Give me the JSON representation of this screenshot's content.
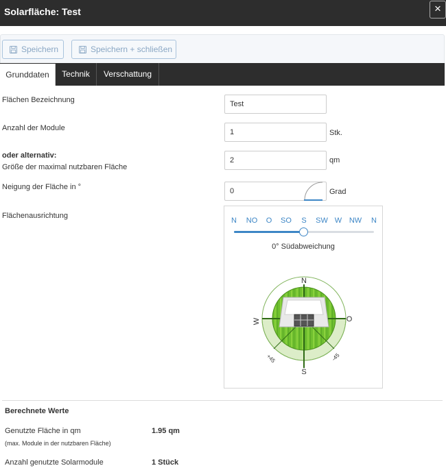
{
  "window": {
    "title": "Solarfläche: Test",
    "close_symbol": "×"
  },
  "toolbar": {
    "save_label": "Speichern",
    "save_close_label": "Speichern + schließen"
  },
  "tabs": [
    {
      "label": "Grunddaten",
      "active": true
    },
    {
      "label": "Technik",
      "active": false
    },
    {
      "label": "Verschattung",
      "active": false
    }
  ],
  "form": {
    "name": {
      "label": "Flächen Bezeichnung",
      "value": "Test"
    },
    "modules": {
      "label": "Anzahl der Module",
      "value": "1",
      "unit": "Stk."
    },
    "area": {
      "label_bold": "oder alternativ:",
      "label": "Größe der maximal nutzbaren Fläche",
      "value": "2",
      "unit": "qm"
    },
    "tilt": {
      "label": "Neigung der Fläche in °",
      "value": "0",
      "unit": "Grad"
    },
    "orientation": {
      "label": "Flächenausrichtung",
      "directions": [
        "N",
        "NO",
        "O",
        "SO",
        "S",
        "SW",
        "W",
        "NW",
        "N"
      ],
      "slider_fraction": 0.5,
      "deviation_text": "0° Südabweichung",
      "compass_labels": {
        "north": "N",
        "east": "O",
        "south": "S",
        "west": "W",
        "plus45": "+45",
        "minus45": "-45"
      }
    }
  },
  "calculated": {
    "heading": "Berechnete Werte",
    "used_area": {
      "label": "Genutzte Fläche in qm",
      "sublabel": "(max. Module in der nutzbaren Fläche)",
      "value": "1.95 qm"
    },
    "modules_used": {
      "label": "Anzahl genutzte Solarmodule",
      "value": "1 Stück"
    }
  },
  "colors": {
    "titlebar": "#2d2d2d",
    "accent_blue": "#3d86c6",
    "compass_green": "#4aa12c",
    "compass_ring": "#dcedc8"
  }
}
